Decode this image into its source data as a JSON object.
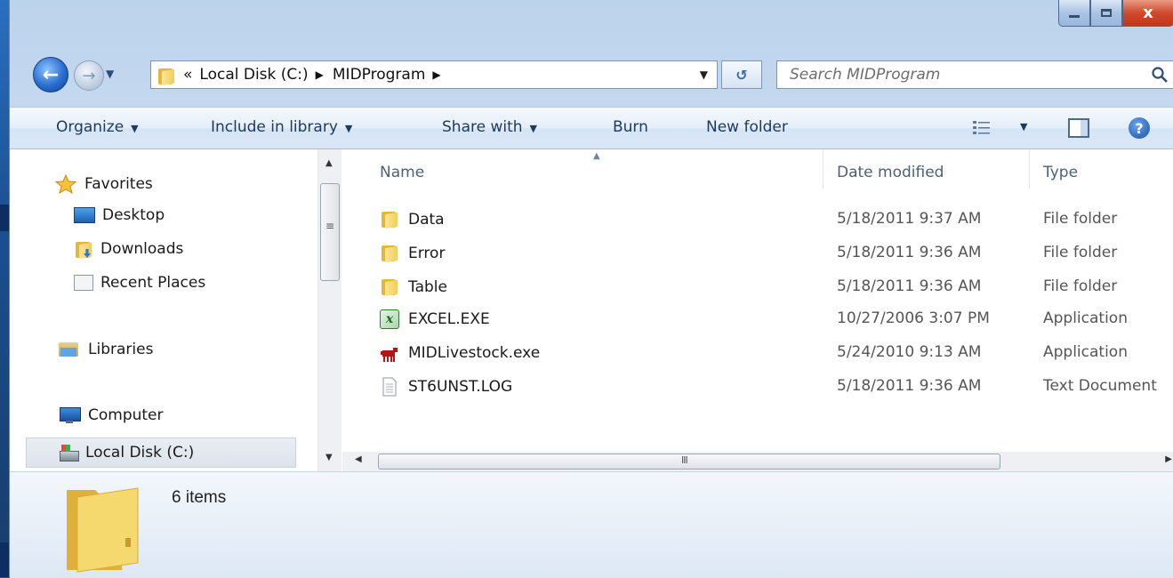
{
  "window": {
    "caption_buttons": {
      "minimize": "",
      "maximize": "",
      "close": "x"
    }
  },
  "nav": {
    "back_glyph": "←",
    "forward_glyph": "→",
    "breadcrumb": {
      "overflow": "«",
      "items": [
        "Local Disk (C:)",
        "MIDProgram"
      ]
    },
    "refresh_glyph": "↺",
    "search_placeholder": "Search MIDProgram"
  },
  "toolbar": {
    "organize": "Organize",
    "include_in_library": "Include in library",
    "share_with": "Share with",
    "burn": "Burn",
    "new_folder": "New folder",
    "help": "?"
  },
  "sidebar": {
    "favorites": {
      "label": "Favorites",
      "items": [
        "Desktop",
        "Downloads",
        "Recent Places"
      ]
    },
    "libraries": "Libraries",
    "computer": {
      "label": "Computer",
      "items": [
        "Local Disk (C:)"
      ]
    }
  },
  "columns": {
    "name": "Name",
    "date_modified": "Date modified",
    "type": "Type"
  },
  "files": [
    {
      "name": "Data",
      "date": "5/18/2011 9:37 AM",
      "type": "File folder",
      "icon": "folder-icon"
    },
    {
      "name": "Error",
      "date": "5/18/2011 9:36 AM",
      "type": "File folder",
      "icon": "folder-icon"
    },
    {
      "name": "Table",
      "date": "5/18/2011 9:36 AM",
      "type": "File folder",
      "icon": "folder-icon"
    },
    {
      "name": "EXCEL.EXE",
      "date": "10/27/2006 3:07 PM",
      "type": "Application",
      "icon": "excel-icon"
    },
    {
      "name": "MIDLivestock.exe",
      "date": "5/24/2010 9:13 AM",
      "type": "Application",
      "icon": "livestock-app-icon"
    },
    {
      "name": "ST6UNST.LOG",
      "date": "5/18/2011 9:36 AM",
      "type": "Text Document",
      "icon": "text-document-icon"
    }
  ],
  "details": {
    "item_count": "6 items"
  },
  "colors": {
    "titlebar": "#bcd3ec",
    "close_button": "#cf4a2a",
    "folder_yellow": "#f3cd57",
    "selection": "#dde3ea"
  }
}
